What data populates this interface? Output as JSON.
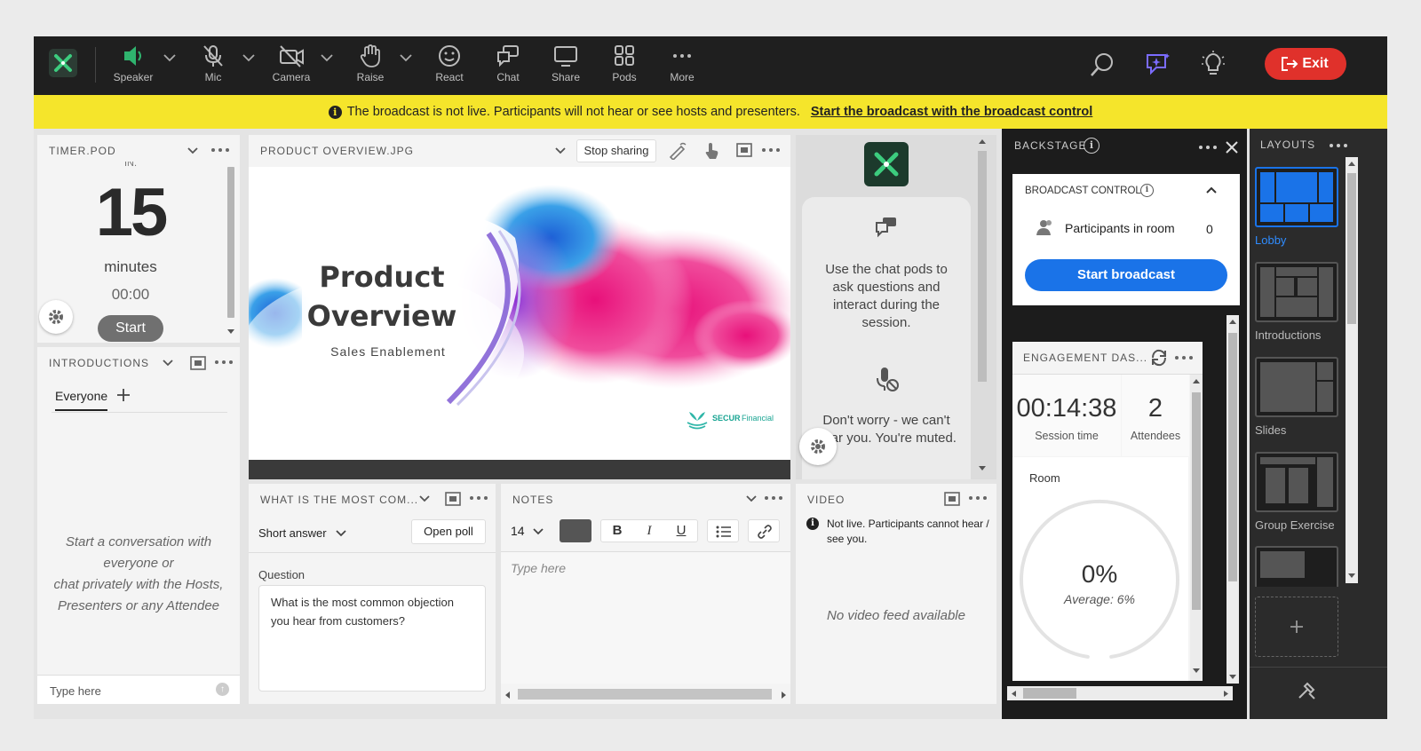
{
  "toolbar": {
    "speaker": "Speaker",
    "mic": "Mic",
    "camera": "Camera",
    "raise": "Raise",
    "react": "React",
    "chat": "Chat",
    "share": "Share",
    "pods": "Pods",
    "more": "More",
    "exit": "Exit"
  },
  "banner": {
    "message": "The broadcast is not live. Participants will not hear or see hosts and presenters.",
    "link": "Start the broadcast with the broadcast control"
  },
  "timer": {
    "title": "TIMER.POD",
    "cut": "IN.",
    "value": "15",
    "unit": "minutes",
    "time": "00:00",
    "start": "Start"
  },
  "introductions": {
    "title": "INTRODUCTIONS",
    "tab": "Everyone",
    "empty1": "Start a conversation with",
    "empty2": "everyone or",
    "empty3": "chat privately with the Hosts,",
    "empty4": "Presenters or any Attendee",
    "placeholder": "Type here"
  },
  "share": {
    "title": "PRODUCT OVERVIEW.JPG",
    "stop": "Stop sharing",
    "slide_title1": "Product",
    "slide_title2": "Overview",
    "slide_subtitle": "Sales Enablement",
    "brand_bold": "SECUR",
    "brand_light": "Financial"
  },
  "chatinfo": {
    "text1": "Use the chat pods to ask questions and interact during the session.",
    "text2": "Don't worry - we can't hear you. You're muted."
  },
  "poll": {
    "title": "WHAT IS THE MOST COM...",
    "type": "Short answer",
    "open": "Open poll",
    "question_label": "Question",
    "question": "What is the most common objection you hear from customers?"
  },
  "notes": {
    "title": "NOTES",
    "font_size": "14",
    "bold": "B",
    "italic": "I",
    "underline": "U",
    "placeholder": "Type here"
  },
  "video": {
    "title": "VIDEO",
    "status": "Not live. Participants cannot hear / see you.",
    "empty": "No video feed available"
  },
  "backstage": {
    "title": "BACKSTAGE",
    "broadcast_title": "BROADCAST CONTROL",
    "participants_label": "Participants in room",
    "participants_count": "0",
    "start": "Start broadcast",
    "engagement_title": "ENGAGEMENT DAS...",
    "session_time": "00:14:38",
    "session_label": "Session time",
    "attendees": "2",
    "attendees_label": "Attendees",
    "room": "Room",
    "percent": "0%",
    "average": "Average: 6%",
    "engagement_fraction": 0.0
  },
  "layouts": {
    "title": "LAYOUTS",
    "items": [
      "Lobby",
      "Introductions",
      "Slides",
      "Group Exercise"
    ]
  },
  "colors": {
    "accent_blue": "#1a73e8",
    "exit_red": "#e0312b",
    "banner_yellow": "#f5e52b",
    "logo_green": "#2fb36e"
  }
}
